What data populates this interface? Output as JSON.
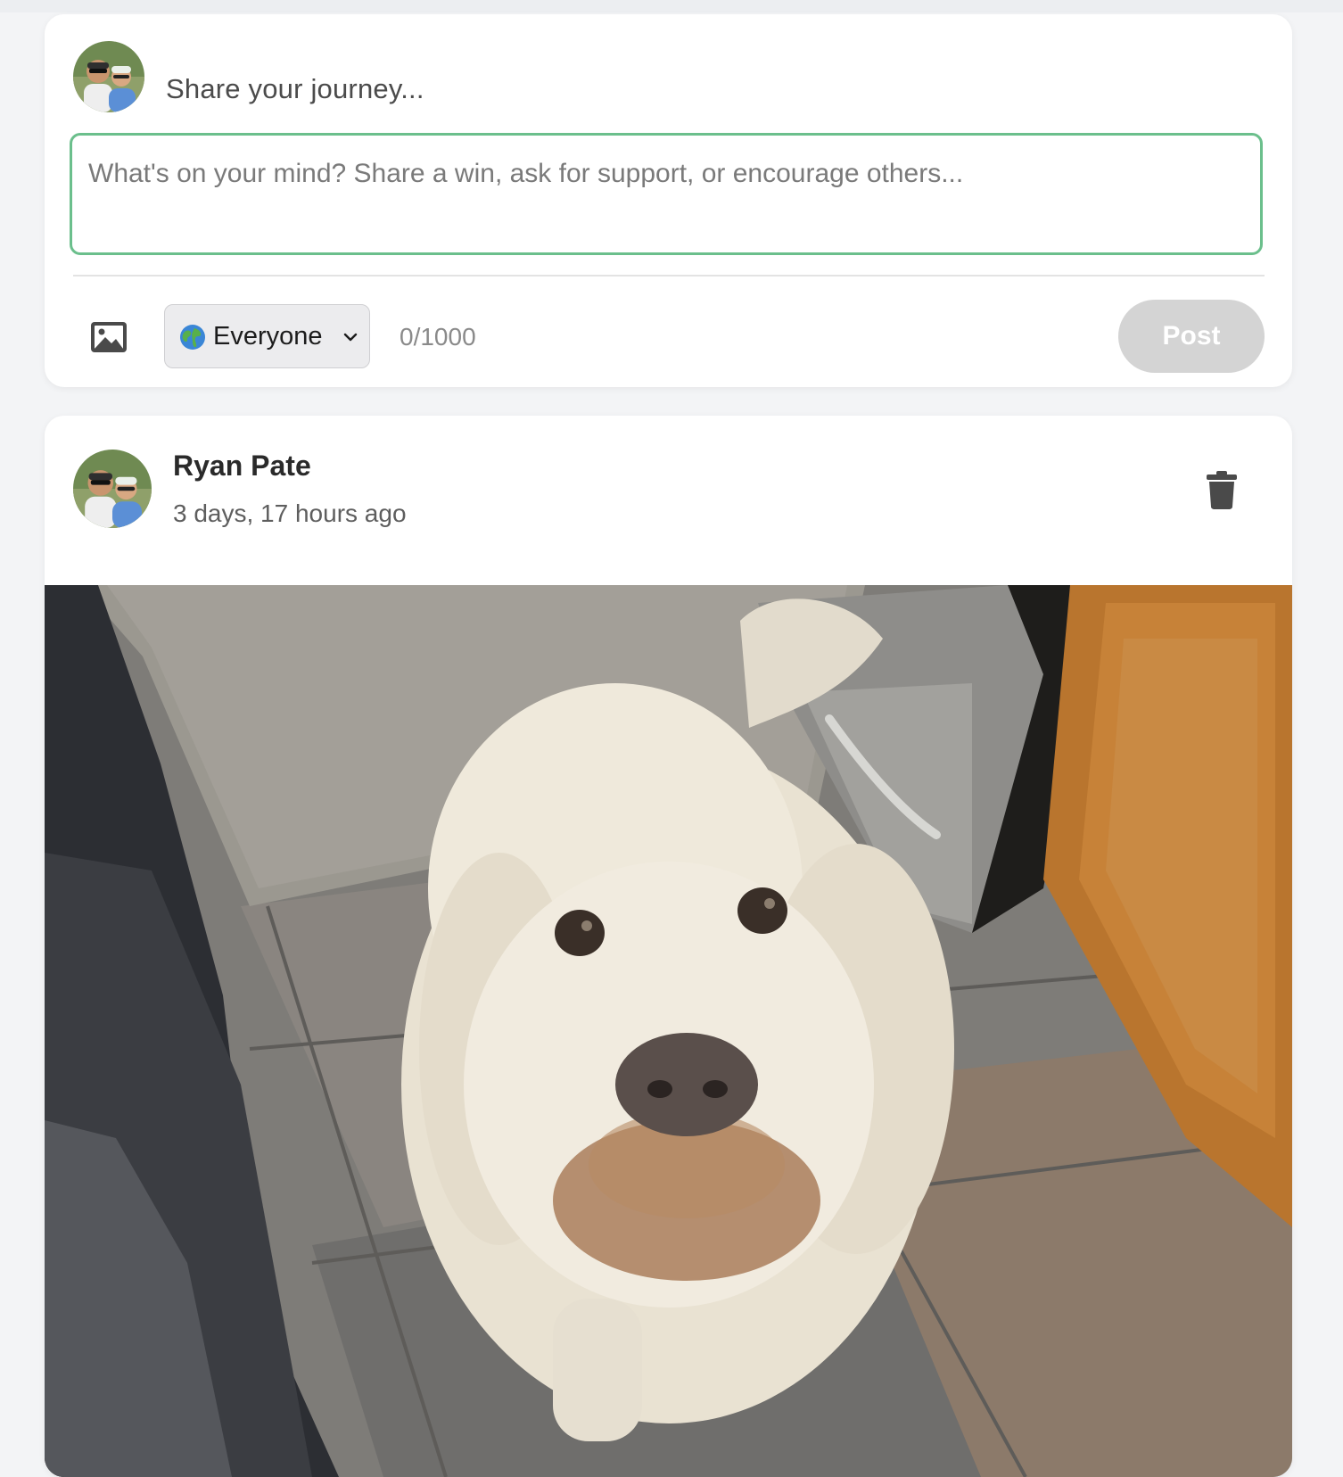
{
  "composer": {
    "heading": "Share your journey...",
    "text_placeholder": "What's on your mind? Share a win, ask for support, or encourage others...",
    "image_icon": "image-icon",
    "audience": {
      "icon": "globe-icon",
      "selected": "Everyone"
    },
    "char_count": "0/1000",
    "post_label": "Post"
  },
  "post": {
    "author": "Ryan Pate",
    "time": "3 days, 17 hours ago",
    "delete_icon": "trash-icon"
  },
  "colors": {
    "focus_border": "#6bbf8c",
    "post_button_disabled": "#d4d4d4",
    "page_background": "#f3f4f6"
  }
}
